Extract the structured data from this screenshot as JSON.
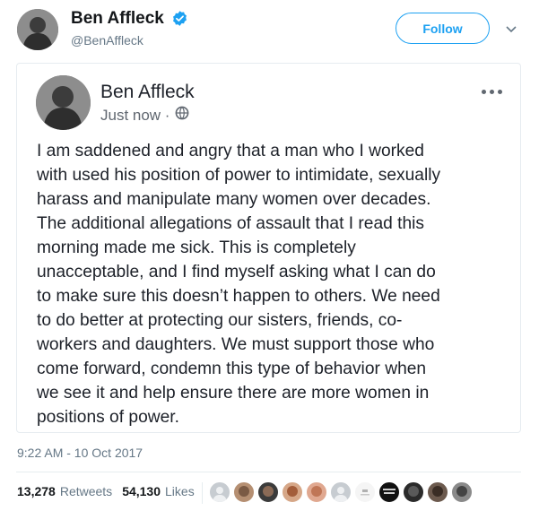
{
  "author": {
    "name": "Ben Affleck",
    "handle": "@BenAffleck",
    "verified_icon": "verified-badge-icon",
    "follow_label": "Follow",
    "menu_icon": "chevron-down-icon"
  },
  "post": {
    "name": "Ben Affleck",
    "meta": "Just now ·",
    "privacy_icon": "globe-icon",
    "more_icon": "more-dots-icon",
    "lines": [
      "I am saddened and angry that a man who I worked",
      "with used his position of power to intimidate, sexually",
      "harass and manipulate many women over decades.",
      "The additional allegations of assault that I read this",
      "morning made me sick. This is completely",
      "unacceptable, and I find myself asking what I can do",
      "to make sure this doesn’t happen to others. We need",
      "to do better at protecting our sisters, friends, co-",
      "workers and daughters. We must support those who",
      "come forward, condemn this type of behavior when",
      "we see it and help ensure there are more women in",
      "positions of power."
    ]
  },
  "tweet": {
    "timestamp": "9:22 AM - 10 Oct 2017",
    "retweets_count": "13,278",
    "retweets_label": "Retweets",
    "likes_count": "54,130",
    "likes_label": "Likes"
  },
  "colors": {
    "accent": "#1da1f2",
    "text": "#14171a",
    "muted": "#657786"
  }
}
